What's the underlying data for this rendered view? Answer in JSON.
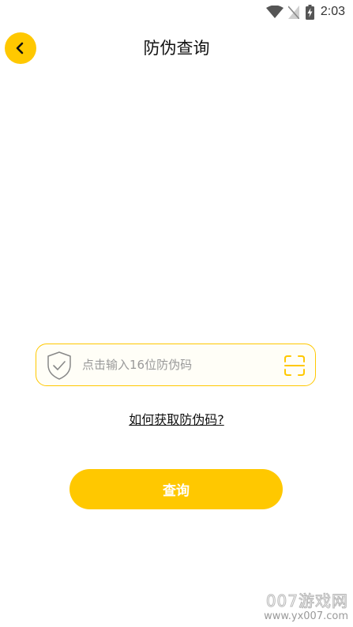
{
  "status_bar": {
    "time": "2:03",
    "icons": [
      "wifi-icon",
      "no-sim-icon",
      "battery-charging-icon"
    ]
  },
  "header": {
    "back_icon": "chevron-left-icon",
    "title": "防伪查询"
  },
  "code_input": {
    "left_icon": "shield-check-icon",
    "placeholder": "点击输入16位防伪码",
    "value": "",
    "right_icon": "scan-icon"
  },
  "help_link": {
    "label": "如何获取防伪码?"
  },
  "query_button": {
    "label": "查询"
  },
  "watermark": {
    "main": "007游戏网",
    "sub": "www.yx007.com"
  },
  "colors": {
    "accent": "#ffc800",
    "background": "#ffffff",
    "text": "#111111",
    "placeholder": "#999999"
  }
}
